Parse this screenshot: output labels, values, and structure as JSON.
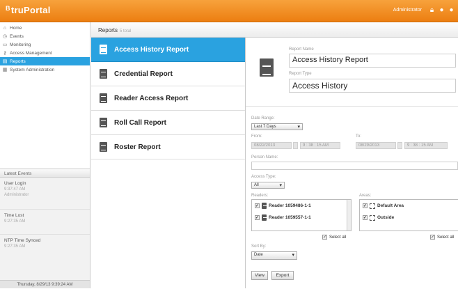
{
  "app": {
    "logo_prefix": "B",
    "logo_text": "truPortal",
    "user": "Administrator"
  },
  "nav": [
    {
      "label": "Home",
      "icon": "home-icon",
      "glyph": "⌂"
    },
    {
      "label": "Events",
      "icon": "clock-icon",
      "glyph": "◷"
    },
    {
      "label": "Monitoring",
      "icon": "monitor-icon",
      "glyph": "▭"
    },
    {
      "label": "Access Management",
      "icon": "key-icon",
      "glyph": "⚿"
    },
    {
      "label": "Reports",
      "icon": "document-icon",
      "glyph": "▤"
    },
    {
      "label": "System Administration",
      "icon": "grid-icon",
      "glyph": "▦"
    }
  ],
  "latest": {
    "title": "Latest Events",
    "events": [
      {
        "name": "User Login",
        "time": "9:37:47 AM",
        "user": "Administrator"
      },
      {
        "name": "Time Lost",
        "time": "9:27:35 AM",
        "user": ""
      },
      {
        "name": "NTP Time Synced",
        "time": "9:27:35 AM",
        "user": ""
      }
    ],
    "clock": "Thursday, 8/29/13 9:39:24 AM"
  },
  "reports_header": {
    "title": "Reports",
    "count": "5 total"
  },
  "reports": [
    "Access History Report",
    "Credential Report",
    "Reader Access Report",
    "Roll Call Report",
    "Roster Report"
  ],
  "detail": {
    "name_label": "Report Name",
    "name_value": "Access History Report",
    "type_label": "Report Type",
    "type_value": "Access History",
    "date_range_label": "Date Range:",
    "date_range_value": "Last 7 Days",
    "from_label": "From:",
    "to_label": "To:",
    "from_date": "08/22/2013",
    "from_time": "9 : 38 : 15 AM",
    "to_date": "08/29/2013",
    "to_time": "9 : 38 : 15 AM",
    "person_label": "Person Name:",
    "access_type_label": "Access Type:",
    "access_type_value": "All",
    "readers_label": "Readers:",
    "readers": [
      "Reader 1059486-1-1",
      "Reader 1059557-1-1"
    ],
    "areas_label": "Areas:",
    "areas": [
      "Default Area",
      "Outside"
    ],
    "select_all": "Select all",
    "select_all_2": "Select all",
    "sort_label": "Sort By:",
    "sort_value": "Date",
    "view_btn": "View",
    "export_btn": "Export"
  }
}
